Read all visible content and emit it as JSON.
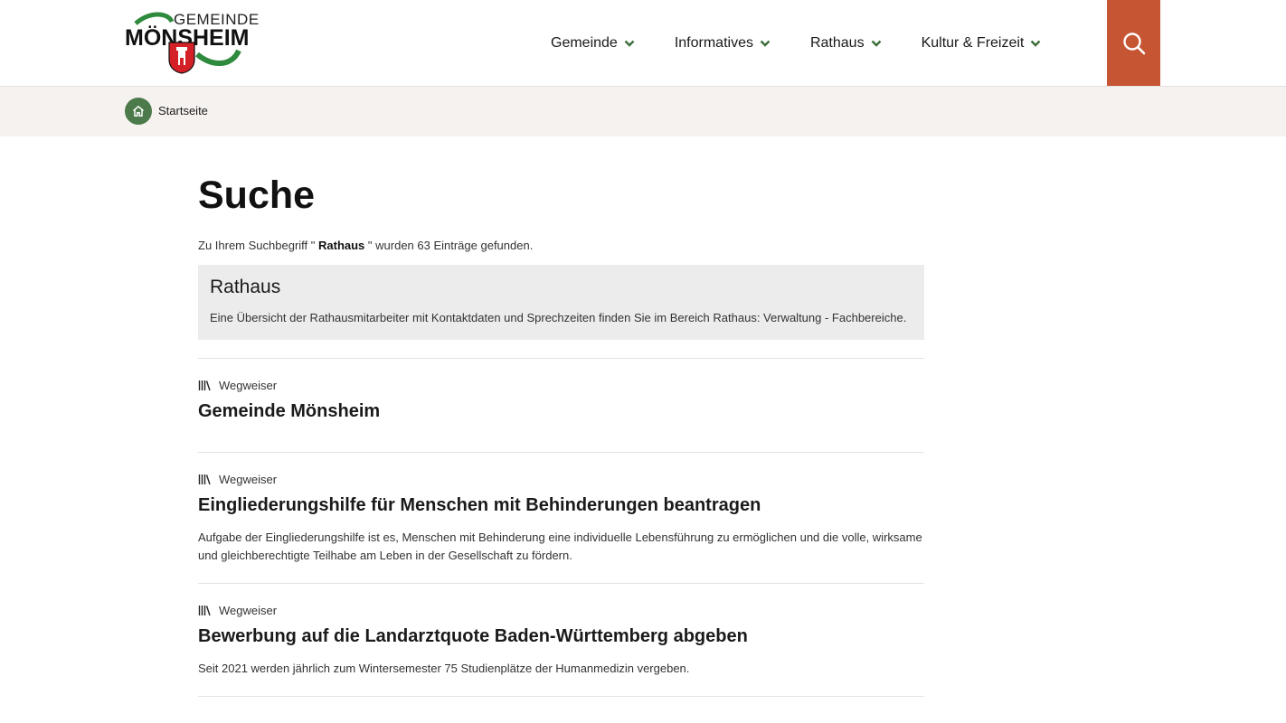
{
  "logo": {
    "top": "GEMEINDE",
    "name": "MÖNSHEIM"
  },
  "nav": [
    {
      "label": "Gemeinde"
    },
    {
      "label": "Informatives"
    },
    {
      "label": "Rathaus"
    },
    {
      "label": "Kultur & Freizeit"
    }
  ],
  "breadcrumb": {
    "label": "Startseite"
  },
  "page": {
    "title": "Suche",
    "info_prefix": "Zu Ihrem Suchbegriff \" ",
    "info_term": "Rathaus",
    "info_suffix": " \" wurden 63 Einträge gefunden."
  },
  "featured": {
    "title": "Rathaus",
    "text": "Eine Übersicht der Rathausmitarbeiter mit Kontaktdaten und Sprechzeiten finden Sie im Bereich Rathaus: Verwaltung - Fachbereiche."
  },
  "results": [
    {
      "category": "Wegweiser",
      "title": "Gemeinde Mönsheim",
      "desc": ""
    },
    {
      "category": "Wegweiser",
      "title": "Eingliederungshilfe für Menschen mit Behinderungen beantragen",
      "desc": "Aufgabe der Eingliederungshilfe ist es, Menschen mit Behinderung eine individuelle Lebensführung zu ermöglichen und die volle, wirksame und gleichberechtigte Teilhabe am Leben in der Gesellschaft zu fördern."
    },
    {
      "category": "Wegweiser",
      "title": "Bewerbung auf die Landarztquote Baden-Württemberg abgeben",
      "desc": "Seit 2021 werden jährlich zum Wintersemester 75 Studienplätze der Humanmedizin vergeben."
    }
  ],
  "colors": {
    "accent": "#c65533",
    "green": "#4c7a4a",
    "breadcrumb_bg": "#f6f2f0",
    "featured_bg": "#ececec"
  }
}
